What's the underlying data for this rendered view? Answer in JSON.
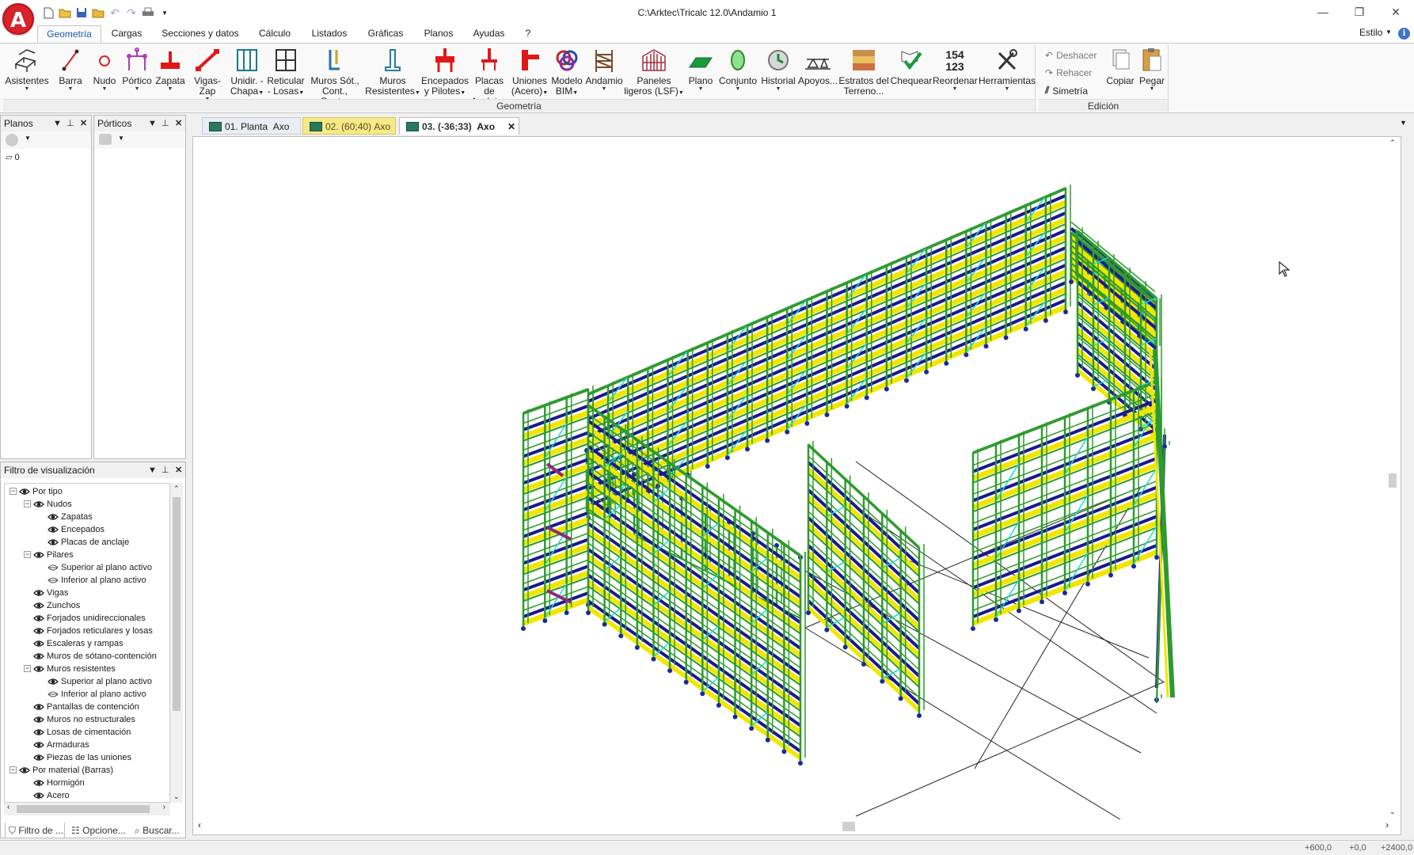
{
  "window": {
    "title": "C:\\Arktec\\Tricalc 12.0\\Andamio 1",
    "app_logo": "A",
    "controls": {
      "minimize": "—",
      "restore": "❐",
      "close": "✕"
    }
  },
  "ribbon_tabs": [
    "Geometría",
    "Cargas",
    "Secciones y datos",
    "Cálculo",
    "Listados",
    "Gráficas",
    "Planos",
    "Ayudas",
    "?"
  ],
  "style_label": "Estilo",
  "ribbon": {
    "geometria_buttons": [
      {
        "l1": "Asistentes",
        "l2": "",
        "icon": "assistant-icon"
      },
      {
        "l1": "Barra",
        "l2": "",
        "icon": "bar-icon"
      },
      {
        "l1": "Nudo",
        "l2": "",
        "icon": "node-icon"
      },
      {
        "l1": "Pórtico",
        "l2": "",
        "icon": "frame-icon"
      },
      {
        "l1": "Zapata",
        "l2": "",
        "icon": "footing-icon"
      },
      {
        "l1": "Vigas-Zap",
        "l2": "",
        "icon": "tie-beam-icon"
      },
      {
        "l1": "Unidir. -",
        "l2": "Chapa",
        "icon": "one-way-slab-icon"
      },
      {
        "l1": "Reticular",
        "l2": "- Losas",
        "icon": "waffle-slab-icon"
      },
      {
        "l1": "Muros Sót.,",
        "l2": "Cont., Pant.",
        "icon": "basement-wall-icon"
      },
      {
        "l1": "Muros",
        "l2": "Resistentes",
        "icon": "bearing-wall-icon"
      },
      {
        "l1": "Encepados",
        "l2": "y Pilotes",
        "icon": "pile-cap-icon"
      },
      {
        "l1": "Placas de",
        "l2": "Anclaje",
        "icon": "anchor-plate-icon"
      },
      {
        "l1": "Uniones",
        "l2": "(Acero)",
        "icon": "steel-joint-icon"
      },
      {
        "l1": "Modelo",
        "l2": "BIM",
        "icon": "bim-model-icon"
      },
      {
        "l1": "Andamio",
        "l2": "",
        "icon": "scaffold-icon"
      },
      {
        "l1": "Paneles",
        "l2": "ligeros (LSF)",
        "icon": "lsf-panel-icon"
      },
      {
        "l1": "Plano",
        "l2": "",
        "icon": "plane-icon"
      },
      {
        "l1": "Conjunto",
        "l2": "",
        "icon": "set-icon"
      },
      {
        "l1": "Historial",
        "l2": "",
        "icon": "history-icon"
      },
      {
        "l1": "Apoyos...",
        "l2": "",
        "icon": "supports-icon"
      },
      {
        "l1": "Estratos del",
        "l2": "Terreno...",
        "icon": "soil-strata-icon"
      },
      {
        "l1": "Chequear",
        "l2": "",
        "icon": "check-icon"
      },
      {
        "l1": "Reordenar",
        "l2": "",
        "icon": "renumber-icon"
      },
      {
        "l1": "Herramientas",
        "l2": "",
        "icon": "tools-icon"
      }
    ],
    "reorder_digits": [
      "154",
      "123"
    ],
    "geometria_label": "Geometría",
    "edicion": {
      "deshacer": "Deshacer",
      "rehacer": "Rehacer",
      "simetria": "Simetría",
      "copiar": "Copiar",
      "pegar": "Pegar",
      "label": "Edición"
    }
  },
  "panels": {
    "planos": {
      "title": "Planos",
      "items": [
        "0"
      ]
    },
    "porticos": {
      "title": "Pórticos"
    },
    "filtro": {
      "title": "Filtro de visualización",
      "tree": [
        {
          "label": "Por tipo",
          "level": 0,
          "expander": "−",
          "visible": true
        },
        {
          "label": "Nudos",
          "level": 1,
          "expander": "−",
          "visible": true
        },
        {
          "label": "Zapatas",
          "level": 2,
          "visible": true
        },
        {
          "label": "Encepados",
          "level": 2,
          "visible": true
        },
        {
          "label": "Placas de anclaje",
          "level": 2,
          "visible": true
        },
        {
          "label": "Pilares",
          "level": 1,
          "expander": "−",
          "visible": true
        },
        {
          "label": "Superior al plano activo",
          "level": 2,
          "visible": false
        },
        {
          "label": "Inferior al plano activo",
          "level": 2,
          "visible": false
        },
        {
          "label": "Vigas",
          "level": 1,
          "visible": true
        },
        {
          "label": "Zunchos",
          "level": 1,
          "visible": true
        },
        {
          "label": "Forjados unidireccionales",
          "level": 1,
          "visible": true
        },
        {
          "label": "Forjados reticulares y losas",
          "level": 1,
          "visible": true
        },
        {
          "label": "Escaleras y rampas",
          "level": 1,
          "visible": true
        },
        {
          "label": "Muros de sótano-contención",
          "level": 1,
          "visible": true
        },
        {
          "label": "Muros resistentes",
          "level": 1,
          "expander": "−",
          "visible": true
        },
        {
          "label": "Superior al plano activo",
          "level": 2,
          "visible": true
        },
        {
          "label": "Inferior al plano activo",
          "level": 2,
          "visible": false
        },
        {
          "label": "Pantallas de contención",
          "level": 1,
          "visible": true
        },
        {
          "label": "Muros no estructurales",
          "level": 1,
          "visible": true
        },
        {
          "label": "Losas de cimentación",
          "level": 1,
          "visible": true
        },
        {
          "label": "Armaduras",
          "level": 1,
          "visible": true
        },
        {
          "label": "Piezas de las uniones",
          "level": 1,
          "visible": true
        },
        {
          "label": "Por material (Barras)",
          "level": 0,
          "expander": "−",
          "visible": true
        },
        {
          "label": "Hormigón",
          "level": 1,
          "visible": true
        },
        {
          "label": "Acero",
          "level": 1,
          "visible": true
        }
      ]
    }
  },
  "doc_tabs": [
    {
      "label": "01. Planta",
      "suffix": "Axo"
    },
    {
      "label": "02. (60;40)",
      "suffix": "Axo"
    },
    {
      "label": "03. (-36;33)",
      "suffix": "Axo"
    }
  ],
  "bottom_tabs": [
    "Filtro de ...",
    "Opcione...",
    "Buscar..."
  ],
  "status": {
    "x": "+600,0",
    "y": "+0,0",
    "z": "+2400,0"
  },
  "colors": {
    "accent": "#1f5aa8",
    "scaffold_frame": "#2e9a2e",
    "scaffold_deck": "#f2e600",
    "scaffold_rail": "#1a1a8c",
    "brace": "#1fd8d8"
  }
}
